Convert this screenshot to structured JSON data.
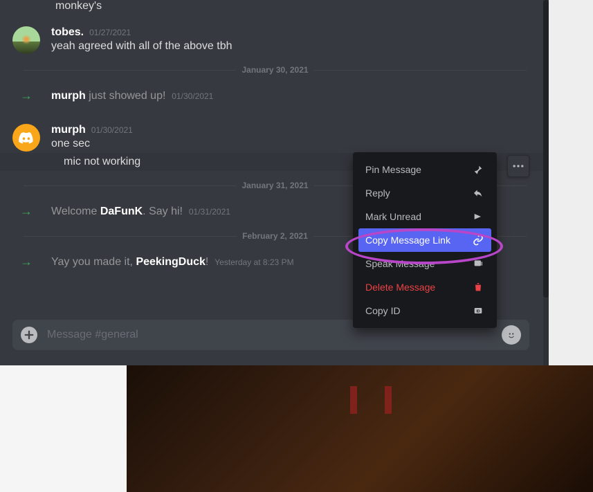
{
  "cutoff_message": "monkey's",
  "messages": [
    {
      "type": "user",
      "username": "tobes.",
      "timestamp": "01/27/2021",
      "text": "yeah agreed with all of the above tbh",
      "avatar": "tobes"
    }
  ],
  "dividers": {
    "d1": "January 30, 2021",
    "d2": "January 31, 2021",
    "d3": "February 2, 2021"
  },
  "system": {
    "s1_pre": "murph",
    "s1_post": " just showed up!",
    "s1_ts": "01/30/2021",
    "s2_pre": "Welcome ",
    "s2_bold": "DaFunK",
    "s2_post": ". Say hi!",
    "s2_ts": "01/31/2021",
    "s3_pre": "Yay you made it, ",
    "s3_bold": "PeekingDuck",
    "s3_post": "!",
    "s3_ts": "Yesterday at 8:23 PM"
  },
  "murph": {
    "username": "murph",
    "timestamp": "01/30/2021",
    "line1": "one sec",
    "line2": "mic not working"
  },
  "context_menu": {
    "pin": "Pin Message",
    "reply": "Reply",
    "mark_unread": "Mark Unread",
    "copy_link": "Copy Message Link",
    "speak": "Speak Message",
    "delete": "Delete Message",
    "copy_id": "Copy ID"
  },
  "input": {
    "placeholder": "Message #general"
  }
}
